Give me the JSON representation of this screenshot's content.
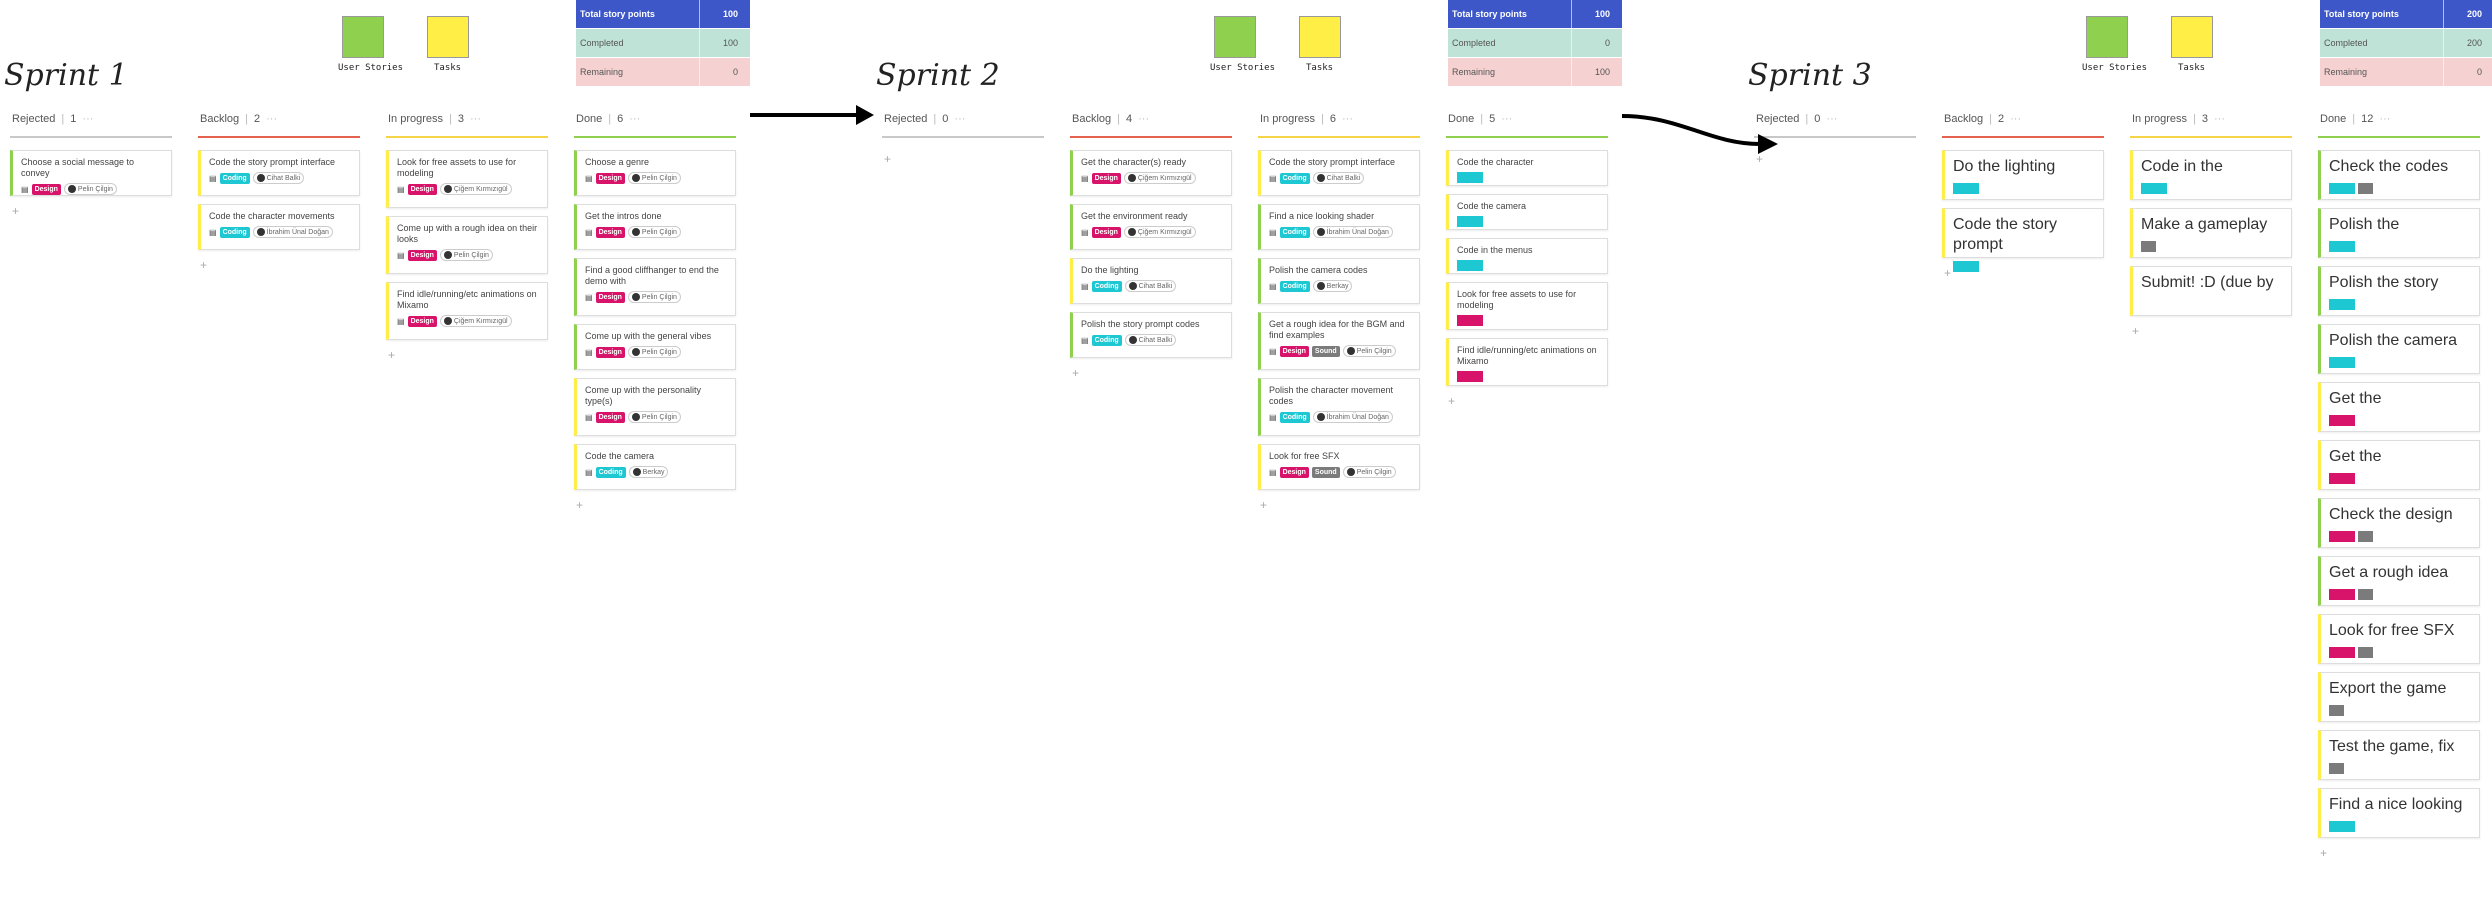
{
  "colors": {
    "design": "#d8136a",
    "coding": "#1ec8d3",
    "sound": "#7b7b7b",
    "yellow": "#ffee45",
    "green": "#8fd14f",
    "blue": "#3d57c9"
  },
  "legend": {
    "user_stories": "User Stories",
    "tasks": "Tasks"
  },
  "sprints": [
    {
      "title": "Sprint 1",
      "total_label": "Total story points",
      "total": "100",
      "completed_label": "Completed",
      "completed": "100",
      "remaining_label": "Remaining",
      "remaining": "0",
      "columns": [
        {
          "name": "Rejected",
          "count": "1",
          "line": "#c8c8c8",
          "cards": [
            {
              "text": "Choose a social message to convey",
              "tags": [
                "Design"
              ],
              "user": "Pelin Çilgin",
              "color": "green"
            }
          ]
        },
        {
          "name": "Backlog",
          "count": "2",
          "line": "#e5624e",
          "cards": [
            {
              "text": "Code the story prompt interface",
              "tags": [
                "Coding"
              ],
              "user": "Cihat Balki",
              "color": "yellow"
            },
            {
              "text": "Code the character movements",
              "tags": [
                "Coding"
              ],
              "user": "İbrahim Ünal Doğan",
              "color": "yellow"
            }
          ]
        },
        {
          "name": "In progress",
          "count": "3",
          "line": "#f5d547",
          "cards": [
            {
              "text": "Look for free assets to use for modeling",
              "tags": [
                "Design"
              ],
              "user": "Çiğem Kırmızıgül",
              "color": "yellow"
            },
            {
              "text": "Come up with a rough idea on their looks",
              "tags": [
                "Design"
              ],
              "user": "Pelin Çilgin",
              "color": "yellow"
            },
            {
              "text": "Find idle/running/etc animations on Mixamo",
              "tags": [
                "Design"
              ],
              "user": "Çiğem Kırmızıgül",
              "color": "yellow"
            }
          ]
        },
        {
          "name": "Done",
          "count": "6",
          "line": "#8fd14f",
          "cards": [
            {
              "text": "Choose a genre",
              "tags": [
                "Design"
              ],
              "user": "Pelin Çilgin",
              "color": "green"
            },
            {
              "text": "Get the intros done",
              "tags": [
                "Design"
              ],
              "user": "Pelin Çilgin",
              "color": "green"
            },
            {
              "text": "Find a good cliffhanger to end the demo with",
              "tags": [
                "Design"
              ],
              "user": "Pelin Çilgin",
              "color": "green"
            },
            {
              "text": "Come up with the general vibes",
              "tags": [
                "Design"
              ],
              "user": "Pelin Çilgin",
              "color": "green"
            },
            {
              "text": "Come up with the personality type(s)",
              "tags": [
                "Design"
              ],
              "user": "Pelin Çilgin",
              "color": "yellow"
            },
            {
              "text": "Code the camera",
              "tags": [
                "Coding"
              ],
              "user": "Berkay",
              "color": "yellow"
            }
          ]
        }
      ]
    },
    {
      "title": "Sprint 2",
      "total_label": "Total story points",
      "total": "100",
      "completed_label": "Completed",
      "completed": "0",
      "remaining_label": "Remaining",
      "remaining": "100",
      "columns": [
        {
          "name": "Rejected",
          "count": "0",
          "line": "#c8c8c8",
          "cards": []
        },
        {
          "name": "Backlog",
          "count": "4",
          "line": "#e5624e",
          "cards": [
            {
              "text": "Get the character(s) ready",
              "tags": [
                "Design"
              ],
              "user": "Çiğem Kırmızıgül",
              "color": "green"
            },
            {
              "text": "Get the environment ready",
              "tags": [
                "Design"
              ],
              "user": "Çiğem Kırmızıgül",
              "color": "green"
            },
            {
              "text": "Do the lighting",
              "tags": [
                "Coding"
              ],
              "user": "Cihat Balki",
              "color": "yellow"
            },
            {
              "text": "Polish the story prompt codes",
              "tags": [
                "Coding"
              ],
              "user": "Cihat Balki",
              "color": "green"
            }
          ]
        },
        {
          "name": "In progress",
          "count": "6",
          "line": "#f5d547",
          "cards": [
            {
              "text": "Code the story prompt interface",
              "tags": [
                "Coding"
              ],
              "user": "Cihat Balki",
              "color": "yellow"
            },
            {
              "text": "Find a nice looking shader",
              "tags": [
                "Coding"
              ],
              "user": "İbrahim Ünal Doğan",
              "color": "green"
            },
            {
              "text": "Polish the camera codes",
              "tags": [
                "Coding"
              ],
              "user": "Berkay",
              "color": "green"
            },
            {
              "text": "Get a rough idea for the BGM and find examples",
              "tags": [
                "Design",
                "Sound"
              ],
              "user": "Pelin Çilgin",
              "color": "green"
            },
            {
              "text": "Polish the character movement codes",
              "tags": [
                "Coding"
              ],
              "user": "İbrahim Ünal Doğan",
              "color": "green"
            },
            {
              "text": "Look for free SFX",
              "tags": [
                "Design",
                "Sound"
              ],
              "user": "Pelin Çilgin",
              "color": "yellow"
            }
          ]
        },
        {
          "name": "Done",
          "count": "5",
          "line": "#8fd14f",
          "cards": [
            {
              "text": "Code the character",
              "tags": [
                "Coding"
              ],
              "color": "yellow"
            },
            {
              "text": "Code the camera",
              "tags": [
                "Coding"
              ],
              "color": "yellow"
            },
            {
              "text": "Code in the menus",
              "tags": [
                "Coding"
              ],
              "color": "yellow"
            },
            {
              "text": "Look for free assets to use for modeling",
              "tags": [
                "Design"
              ],
              "color": "yellow"
            },
            {
              "text": "Find idle/running/etc animations on Mixamo",
              "tags": [
                "Design"
              ],
              "color": "yellow"
            }
          ]
        }
      ]
    },
    {
      "title": "Sprint 3",
      "total_label": "Total story points",
      "total": "200",
      "completed_label": "Completed",
      "completed": "200",
      "remaining_label": "Remaining",
      "remaining": "0",
      "columns": [
        {
          "name": "Rejected",
          "count": "0",
          "line": "#c8c8c8",
          "cards": []
        },
        {
          "name": "Backlog",
          "count": "2",
          "line": "#e5624e",
          "cards": [
            {
              "text": "Do the lighting",
              "tags": [
                "Coding"
              ],
              "color": "yellow"
            },
            {
              "text": "Code the story prompt",
              "tags": [
                "Coding"
              ],
              "color": "yellow"
            }
          ]
        },
        {
          "name": "In progress",
          "count": "3",
          "line": "#f5d547",
          "cards": [
            {
              "text": "Code in the",
              "tags": [
                "Coding"
              ],
              "color": "yellow"
            },
            {
              "text": "Make a gameplay",
              "tags": [
                "Sound"
              ],
              "color": "yellow"
            },
            {
              "text": "Submit! :D (due by",
              "tags": [],
              "color": "yellow"
            }
          ]
        },
        {
          "name": "Done",
          "count": "12",
          "line": "#8fd14f",
          "cards": [
            {
              "text": "Check the codes",
              "tags": [
                "Coding",
                "Sound"
              ],
              "color": "green"
            },
            {
              "text": "Polish the",
              "tags": [
                "Coding"
              ],
              "color": "green"
            },
            {
              "text": "Polish the story",
              "tags": [
                "Coding"
              ],
              "color": "green"
            },
            {
              "text": "Polish the camera",
              "tags": [
                "Coding"
              ],
              "color": "green"
            },
            {
              "text": "Get the",
              "tags": [
                "Design"
              ],
              "color": "yellow"
            },
            {
              "text": "Get the",
              "tags": [
                "Design"
              ],
              "color": "yellow"
            },
            {
              "text": "Check the design",
              "tags": [
                "Design",
                "Sound"
              ],
              "color": "green"
            },
            {
              "text": "Get a rough idea",
              "tags": [
                "Design",
                "Sound"
              ],
              "color": "green"
            },
            {
              "text": "Look for free SFX",
              "tags": [
                "Design",
                "Sound"
              ],
              "color": "yellow"
            },
            {
              "text": "Export the game",
              "tags": [
                "Sound"
              ],
              "color": "yellow"
            },
            {
              "text": "Test the game, fix",
              "tags": [
                "Sound"
              ],
              "color": "yellow"
            },
            {
              "text": "Find a nice looking",
              "tags": [
                "Coding"
              ],
              "color": "yellow"
            }
          ]
        }
      ]
    }
  ]
}
